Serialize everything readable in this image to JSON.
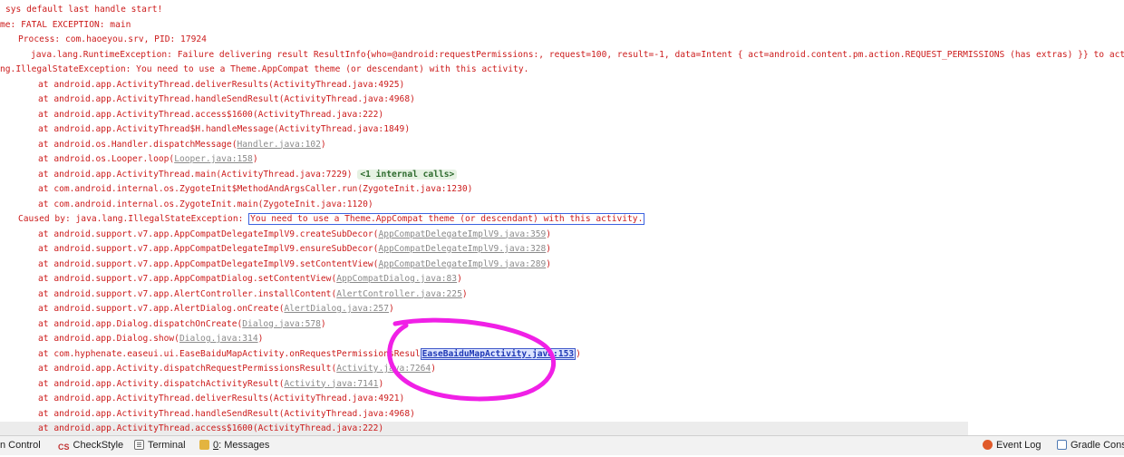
{
  "console": {
    "lines": [
      {
        "indent": 1,
        "parts": [
          {
            "t": "sys default last handle start!"
          }
        ]
      },
      {
        "indent": 0,
        "parts": [
          {
            "t": "me: FATAL EXCEPTION: main"
          }
        ]
      },
      {
        "indent": 3,
        "parts": [
          {
            "t": "Process: com.haoeyou.srv, PID: 17924"
          }
        ]
      },
      {
        "indent": 4,
        "parts": [
          {
            "t": "java.lang.RuntimeException: Failure delivering result ResultInfo{who=@android:requestPermissions:, request=100, result=-1, data=Intent { act=android.content.pm.action.REQUEST_PERMISSIONS (has extras) }} to activity {com.haoeyou"
          }
        ]
      },
      {
        "indent": 0,
        "parts": [
          {
            "t": "ng.IllegalStateException: You need to use a Theme.AppCompat theme (or descendant) with this activity."
          }
        ]
      },
      {
        "indent": 5,
        "parts": [
          {
            "t": "at android.app.ActivityThread.deliverResults(ActivityThread.java:4925)"
          }
        ]
      },
      {
        "indent": 5,
        "parts": [
          {
            "t": "at android.app.ActivityThread.handleSendResult(ActivityThread.java:4968)"
          }
        ]
      },
      {
        "indent": 5,
        "parts": [
          {
            "t": "at android.app.ActivityThread.access$1600(ActivityThread.java:222)"
          }
        ]
      },
      {
        "indent": 5,
        "parts": [
          {
            "t": "at android.app.ActivityThread$H.handleMessage(ActivityThread.java:1849)"
          }
        ]
      },
      {
        "indent": 5,
        "parts": [
          {
            "t": "at android.os.Handler.dispatchMessage("
          },
          {
            "t": "Handler.java:102",
            "link": true
          },
          {
            "t": ")"
          }
        ]
      },
      {
        "indent": 5,
        "parts": [
          {
            "t": "at android.os.Looper.loop("
          },
          {
            "t": "Looper.java:158",
            "link": true
          },
          {
            "t": ")"
          }
        ]
      },
      {
        "indent": 5,
        "parts": [
          {
            "t": "at android.app.ActivityThread.main(ActivityThread.java:7229) "
          },
          {
            "t": "<1 internal calls>",
            "fold": true
          }
        ]
      },
      {
        "indent": 5,
        "parts": [
          {
            "t": "at com.android.internal.os.ZygoteInit$MethodAndArgsCaller.run(ZygoteInit.java:1230)"
          }
        ]
      },
      {
        "indent": 5,
        "parts": [
          {
            "t": "at com.android.internal.os.ZygoteInit.main(ZygoteInit.java:1120)"
          }
        ]
      },
      {
        "indent": 3,
        "parts": [
          {
            "t": "Caused by: java.lang.IllegalStateException: "
          },
          {
            "t": "You need to use a Theme.AppCompat theme (or descendant) with this activity.",
            "box": true
          }
        ]
      },
      {
        "indent": 5,
        "parts": [
          {
            "t": "at android.support.v7.app.AppCompatDelegateImplV9.createSubDecor("
          },
          {
            "t": "AppCompatDelegateImplV9.java:359",
            "link": true
          },
          {
            "t": ")"
          }
        ]
      },
      {
        "indent": 5,
        "parts": [
          {
            "t": "at android.support.v7.app.AppCompatDelegateImplV9.ensureSubDecor("
          },
          {
            "t": "AppCompatDelegateImplV9.java:328",
            "link": true
          },
          {
            "t": ")"
          }
        ]
      },
      {
        "indent": 5,
        "parts": [
          {
            "t": "at android.support.v7.app.AppCompatDelegateImplV9.setContentView("
          },
          {
            "t": "AppCompatDelegateImplV9.java:289",
            "link": true
          },
          {
            "t": ")"
          }
        ]
      },
      {
        "indent": 5,
        "parts": [
          {
            "t": "at android.support.v7.app.AppCompatDialog.setContentView("
          },
          {
            "t": "AppCompatDialog.java:83",
            "link": true
          },
          {
            "t": ")"
          }
        ]
      },
      {
        "indent": 5,
        "parts": [
          {
            "t": "at android.support.v7.app.AlertController.installContent("
          },
          {
            "t": "AlertController.java:225",
            "link": true
          },
          {
            "t": ")"
          }
        ]
      },
      {
        "indent": 5,
        "parts": [
          {
            "t": "at android.support.v7.app.AlertDialog.onCreate("
          },
          {
            "t": "AlertDialog.java:257",
            "link": true
          },
          {
            "t": ")"
          }
        ]
      },
      {
        "indent": 5,
        "parts": [
          {
            "t": "at android.app.Dialog.dispatchOnCreate("
          },
          {
            "t": "Dialog.java:578",
            "link": true
          },
          {
            "t": ")"
          }
        ]
      },
      {
        "indent": 5,
        "parts": [
          {
            "t": "at android.app.Dialog.show("
          },
          {
            "t": "Dialog.java:314",
            "link": true
          },
          {
            "t": ")"
          }
        ]
      },
      {
        "indent": 5,
        "parts": [
          {
            "t": "at com.hyphenate.easeui.ui.EaseBaiduMapActivity.onRequestPermissionsResul"
          },
          {
            "t": "EaseBaiduMapActivity.java:153",
            "link": true,
            "active": true
          },
          {
            "t": ")"
          }
        ]
      },
      {
        "indent": 5,
        "parts": [
          {
            "t": "at android.app.Activity.dispatchRequestPermissionsResult("
          },
          {
            "t": "Activity.java:7264",
            "link": true
          },
          {
            "t": ")"
          }
        ]
      },
      {
        "indent": 5,
        "parts": [
          {
            "t": "at android.app.Activity.dispatchActivityResult("
          },
          {
            "t": "Activity.java:7141",
            "link": true
          },
          {
            "t": ")"
          }
        ]
      },
      {
        "indent": 5,
        "parts": [
          {
            "t": "at android.app.ActivityThread.deliverResults(ActivityThread.java:4921)"
          }
        ]
      },
      {
        "indent": 5,
        "parts": [
          {
            "t": "at android.app.ActivityThread.handleSendResult(ActivityThread.java:4968)"
          }
        ]
      },
      {
        "indent": 5,
        "parts": [
          {
            "t": "at android.app.ActivityThread.access$1600(ActivityThread.java:222)"
          }
        ],
        "highlight": true
      }
    ]
  },
  "annotation": {
    "color": "#f020e6"
  },
  "bottom_bar": {
    "left_tabs": [
      {
        "label": "n Control",
        "icon": ""
      },
      {
        "label": "CheckStyle",
        "icon": "checkstyle-icon",
        "glyph": "CS"
      },
      {
        "label": "Terminal",
        "icon": "terminal-icon"
      },
      {
        "label": "Messages",
        "mnemonic": "0",
        "icon": "messages-icon"
      }
    ],
    "right_tabs": [
      {
        "label": "Event Log",
        "icon": "event-log-icon"
      },
      {
        "label": "Gradle Conso",
        "icon": "gradle-console-icon"
      }
    ]
  }
}
